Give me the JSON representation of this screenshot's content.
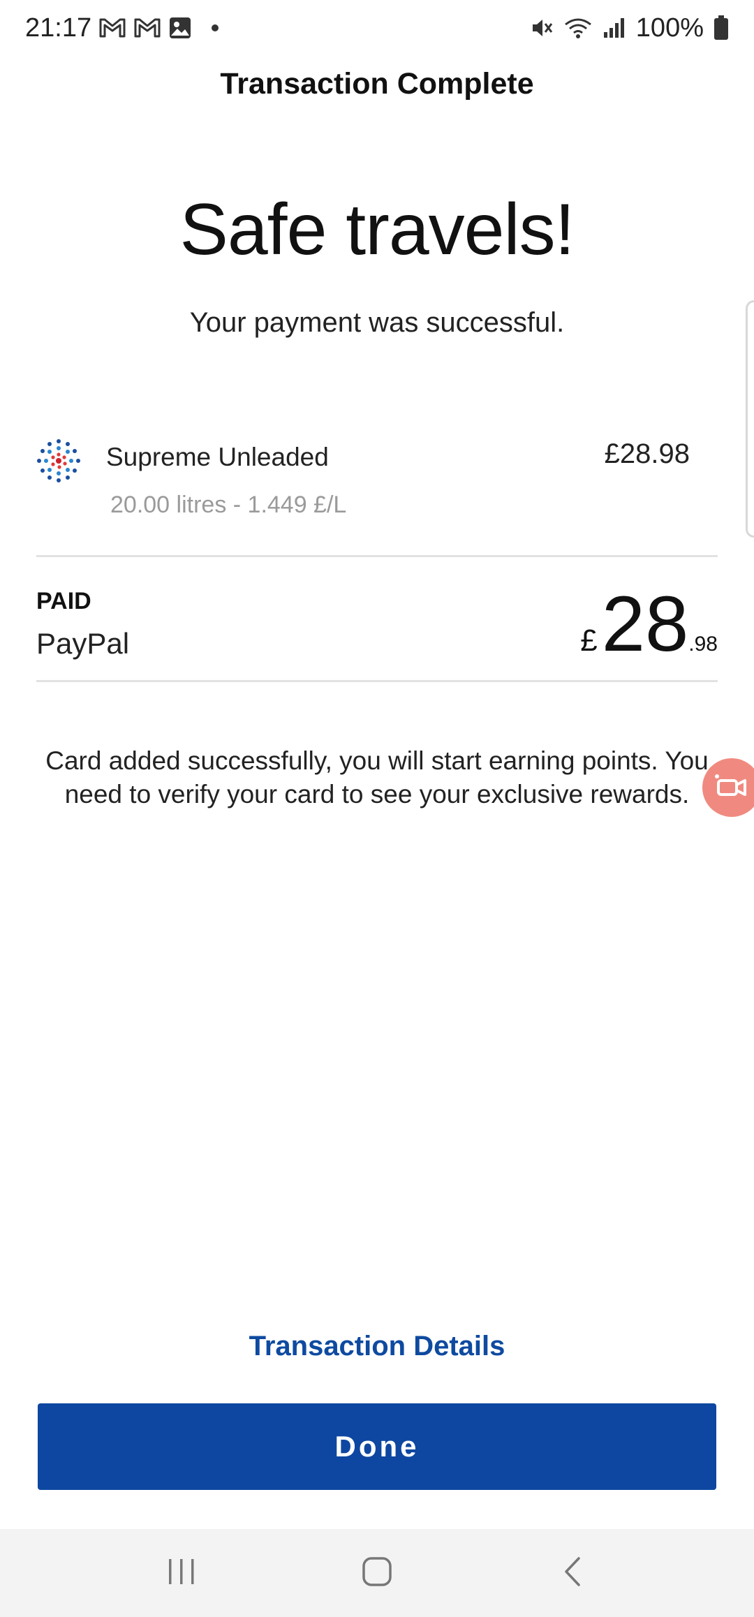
{
  "status_bar": {
    "time": "21:17",
    "battery": "100%"
  },
  "header": {
    "title": "Transaction Complete"
  },
  "main": {
    "headline": "Safe travels!",
    "subheadline": "Your payment was successful.",
    "fuel_item": {
      "name": "Supreme Unleaded",
      "price": "£28.98",
      "detail": "20.00 litres - 1.449 £/L"
    },
    "payment": {
      "status_label": "PAID",
      "method": "PayPal",
      "currency_symbol": "£",
      "amount_major": "28",
      "amount_minor": ".98"
    },
    "notice": "Card added successfully, you will start earning points. You need to verify your card to see your exclusive rewards."
  },
  "footer": {
    "details_link": "Transaction Details",
    "done_label": "Done"
  },
  "colors": {
    "primary": "#0d47a1",
    "link": "#0e4aa0",
    "record_fab": "#f08a80"
  },
  "icons": {
    "status_left": [
      "gmail-icon",
      "gmail-icon",
      "gallery-icon"
    ],
    "status_right": [
      "mute-icon",
      "wifi-icon",
      "signal-icon",
      "battery-icon"
    ],
    "nav": [
      "recent-apps-icon",
      "home-icon",
      "back-icon"
    ]
  }
}
